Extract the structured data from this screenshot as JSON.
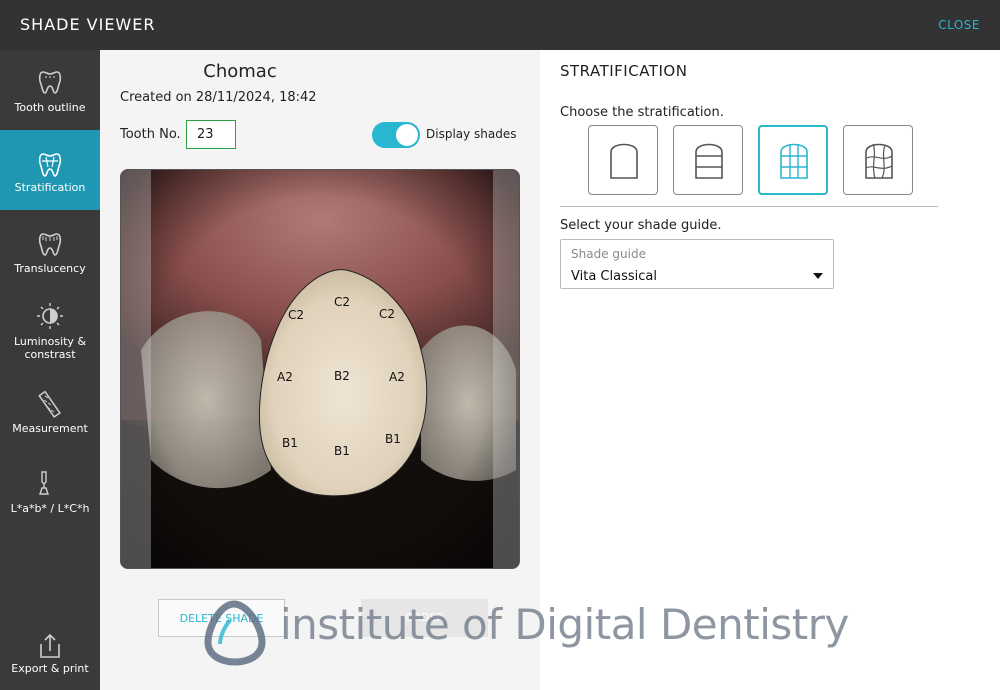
{
  "window": {
    "title": "SHADE VIEWER",
    "close_label": "CLOSE"
  },
  "sidebar": {
    "items": [
      {
        "label": "Tooth outline",
        "icon": "tooth-outline-icon",
        "active": false
      },
      {
        "label": "Stratification",
        "icon": "stratification-icon",
        "active": true
      },
      {
        "label": "Translucency",
        "icon": "translucency-icon",
        "active": false
      },
      {
        "label": "Luminosity & constrast",
        "icon": "luminosity-icon",
        "active": false
      },
      {
        "label": "Measurement",
        "icon": "ruler-icon",
        "active": false
      },
      {
        "label": "L*a*b* / L*C*h",
        "icon": "pipette-icon",
        "active": false
      },
      {
        "label": "Export & print",
        "icon": "export-icon",
        "active": false
      }
    ]
  },
  "case": {
    "patient_name": "Chomac",
    "created": "Created on 28/11/2024, 18:42",
    "tooth_label": "Tooth No.",
    "tooth_number": "23",
    "display_shades_label": "Display shades",
    "display_shades_on": true
  },
  "shade_map": {
    "labels": [
      {
        "text": "C2"
      },
      {
        "text": "C2"
      },
      {
        "text": "C2"
      },
      {
        "text": "A2"
      },
      {
        "text": "B2"
      },
      {
        "text": "A2"
      },
      {
        "text": "B1"
      },
      {
        "text": "B1"
      },
      {
        "text": "B1"
      }
    ]
  },
  "actions": {
    "delete_label": "DELETE SHADE",
    "order_label": "ORDER"
  },
  "stratification": {
    "title": "STRATIFICATION",
    "choose_label": "Choose the stratification.",
    "options": [
      {
        "name": "single-layer",
        "selected": false
      },
      {
        "name": "horizontal-layers",
        "selected": false
      },
      {
        "name": "grid",
        "selected": true
      },
      {
        "name": "freeform",
        "selected": false
      }
    ],
    "select_guide_label": "Select your shade guide.",
    "guide_placeholder": "Shade guide",
    "guide_value": "Vita Classical"
  },
  "watermark": {
    "text": "institute of Digital Dentistry"
  },
  "colors": {
    "accent": "#29b6d0",
    "sidebar": "#3a3a3a",
    "topbar": "#333333",
    "active_item": "#1f97b3",
    "field_border": "#2ea043"
  }
}
